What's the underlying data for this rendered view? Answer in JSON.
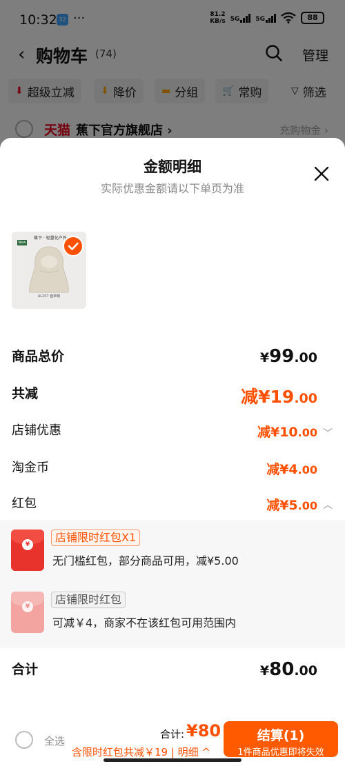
{
  "status_bar": {
    "time": "10:32",
    "app_icon_text": "32",
    "more": "···",
    "net_speed_value": "81.2",
    "net_speed_unit": "KB/s",
    "signal1": "5G",
    "signal2": "5G",
    "battery": "88"
  },
  "cart_header": {
    "back": "‹",
    "title": "购物车",
    "count": "(74)",
    "manage": "管理"
  },
  "filters": {
    "chip1": "超级立减",
    "chip2": "降价",
    "chip3": "分组",
    "chip4": "常购",
    "chip5": "筛选"
  },
  "store": {
    "platform": "天猫",
    "name": "蕉下官方旗舰店 ›",
    "promo": "充购物金 ›"
  },
  "sheet": {
    "title": "金额明细",
    "subtitle": "实际优惠金额请以下单页为准",
    "product": {
      "brand_text": "蕉下 · 轻量化户外",
      "new_tag": "New",
      "caption": "AL207 面罩帽"
    },
    "rows": {
      "total_label": "商品总价",
      "total_currency": "¥",
      "total_int": "99",
      "total_dec": ".00",
      "discount_label": "共减",
      "discount_value": "减¥19",
      "discount_dec": ".00",
      "shop_label": "店铺优惠",
      "shop_value": "减¥10",
      "shop_dec": ".00",
      "coin_label": "淘金币",
      "coin_value": "减¥4",
      "coin_dec": ".00",
      "redpacket_label": "红包",
      "redpacket_value": "减¥5",
      "redpacket_dec": ".00"
    },
    "coupons": [
      {
        "tag": "店铺限时红包X1",
        "desc": "无门槛红包，部分商品可用，减¥5.00"
      },
      {
        "tag": "店铺限时红包",
        "desc": "可减￥4，商家不在该红包可用范围内"
      }
    ],
    "sum_label": "合计",
    "sum_currency": "¥",
    "sum_int": "80",
    "sum_dec": ".00"
  },
  "bottom_bar": {
    "select_all": "全选",
    "sum_label": "合计:",
    "sum_value": "¥80",
    "note": "含限时红包共减￥19 | 明细 ^",
    "checkout_label": "结算(1)",
    "checkout_note": "1件商品优惠即将失效"
  },
  "colors": {
    "accent": "#ff5000",
    "tmall_red": "#e0001b",
    "overlay": "rgba(0,0,0,0.48)"
  }
}
